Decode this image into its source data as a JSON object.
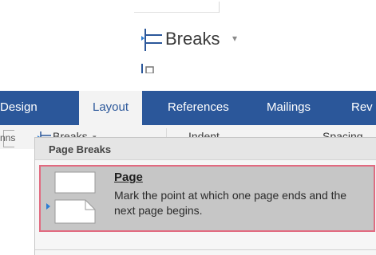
{
  "zoomed_control": {
    "label": "Breaks",
    "caret": "▾",
    "icon": "page-breaks-icon"
  },
  "ribbon": {
    "tabs": [
      {
        "label": "Design"
      },
      {
        "label": "Layout",
        "active": true
      },
      {
        "label": "References"
      },
      {
        "label": "Mailings"
      },
      {
        "label": "Rev"
      }
    ],
    "toolbar": {
      "breaks_label": "Breaks",
      "breaks_caret": "▾",
      "indent_label": "Indent",
      "spacing_label": "Spacing"
    },
    "columns_fragment": "nns"
  },
  "menu": {
    "section_header": "Page Breaks",
    "items": [
      {
        "title": "Page",
        "description": "Mark the point at which one page ends and the next page begins.",
        "icon": "page-break-icon",
        "highlighted": true
      }
    ]
  },
  "colors": {
    "ribbon_blue": "#2b579a",
    "highlight_border": "#e26a80",
    "selected_item_bg": "#c6c6c6"
  }
}
